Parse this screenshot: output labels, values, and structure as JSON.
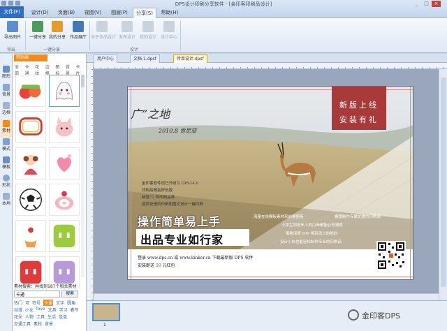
{
  "app": {
    "title": "DPS设计印刷分享软件 - [金印客印刷品设计]"
  },
  "ribbon_tabs": {
    "file": "文件(F)",
    "tabs": [
      "设计(D)",
      "页面(B)",
      "视图(V)",
      "图层(P)",
      "分享(S)",
      "帮助(H)"
    ],
    "active": "分享(S)"
  },
  "ribbon": {
    "groups": [
      {
        "label": "导出",
        "buttons": [
          "导出图片"
        ]
      },
      {
        "label": "一键分享",
        "buttons": [
          "一键分享",
          "我的分享",
          "作品展厅"
        ]
      },
      {
        "label": "设计",
        "buttons": [
          "关于作品设计",
          "发布设计",
          "我的设计",
          "设计中心"
        ]
      }
    ]
  },
  "left_rail": [
    "图形",
    "背景",
    "边框",
    "素材",
    "模式",
    "模板",
    "形状",
    "本地"
  ],
  "left_panel": {
    "title": "剪贴画",
    "tabs": [
      "全部",
      "卡通",
      "花纹",
      "边框",
      "图标",
      "背景",
      "卡片"
    ],
    "stickers": [
      "strawberry-icon",
      "ghost-icon",
      "frame-icon",
      "cat-icon",
      "doll-icon",
      "heart-icon",
      "soccer-ball-icon",
      "cake-roll-icon",
      "cupcake-icon",
      "green-box-icon",
      "red-box-icon",
      "purple-box-icon"
    ],
    "result_text": "素材搜索：共找到187个相关素材",
    "search_value": "卡通",
    "search_button": "搜索",
    "tags": [
      "热门",
      "可",
      "符号",
      "卡通",
      "文字",
      "圆角",
      "动漫",
      "小女",
      "love",
      "文具",
      "学习",
      "春节",
      "花朵",
      "人物",
      "工具",
      "生活",
      "圣诞",
      "交通工具",
      "素材",
      "背景"
    ],
    "selected_tag": "卡通"
  },
  "doc_tabs": [
    "用户中心",
    "文档-1.dpsf",
    "传单设计.dpsf"
  ],
  "active_doc_tab": "传单设计.dpsf",
  "flyer": {
    "red_box_line1": "新版上线",
    "red_box_line2": "安装有礼",
    "handwriting1": "广”之地",
    "handwriting2": "2010.8 肯尼亚",
    "intro_lines": [
      "金印客软件现已升级为 DPS14.9",
      "印刷品随金好玩版",
      "新增72 种印刷品种",
      "提供快速的印刷和图文设计一键印刷"
    ],
    "feature_lines": [
      "海量在线模板素材来前模更新",
      "模版制作专属优惠的印刷品",
      "小学生到老年人的口味都能让你满意",
      "细胞深度 DIY 将玩设计的绝妙",
      "设计小白也能轻松制作专业的印刷品"
    ],
    "headline1": "操作简单易上手",
    "headline2": "出品专业如行家",
    "footer_line1": "登录 www.dps.cn  或  www.kinker.cn  下载最新版 DPS 软件",
    "footer_line2_prefix": "安装即送 ",
    "footer_price": "50",
    "footer_line2_suffix": " 元红包"
  },
  "page_strip": {
    "page_number": "1"
  },
  "watermark": {
    "text": "金印客DPS"
  },
  "colors": {
    "accent": "#f38b1a",
    "ribbon_file": "#2e6fc2",
    "flyer_red": "#a93a3a"
  }
}
